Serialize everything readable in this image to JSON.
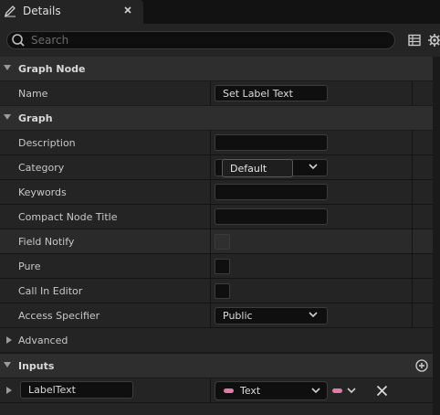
{
  "tab": {
    "title": "Details",
    "icon": "pencil-icon",
    "close_icon": "close-icon"
  },
  "search": {
    "placeholder": "Search",
    "value": ""
  },
  "toolbar": {
    "icons": [
      "table-view-icon",
      "settings-gear-icon"
    ]
  },
  "sections": {
    "graph_node": {
      "title": "Graph Node",
      "name_label": "Name",
      "name_value": "Set Label Text"
    },
    "graph": {
      "title": "Graph",
      "description_label": "Description",
      "description_value": "",
      "category_label": "Category",
      "category_value": "Default",
      "keywords_label": "Keywords",
      "keywords_value": "",
      "compact_title_label": "Compact Node Title",
      "compact_title_value": "",
      "field_notify_label": "Field Notify",
      "field_notify_checked": false,
      "pure_label": "Pure",
      "pure_checked": false,
      "call_in_editor_label": "Call In Editor",
      "call_in_editor_checked": false,
      "access_label": "Access Specifier",
      "access_value": "Public"
    },
    "advanced": {
      "title": "Advanced"
    },
    "inputs": {
      "title": "Inputs",
      "add_icon": "plus-circle-icon",
      "params": [
        {
          "name": "LabelText",
          "type": "Text",
          "type_color": "#e07aa8"
        }
      ]
    }
  },
  "colors": {
    "background": "#1a1a1a",
    "section": "#2e2e2e",
    "row": "#242424",
    "field": "#0f0f0f",
    "text_pin": "#e07aa8"
  }
}
